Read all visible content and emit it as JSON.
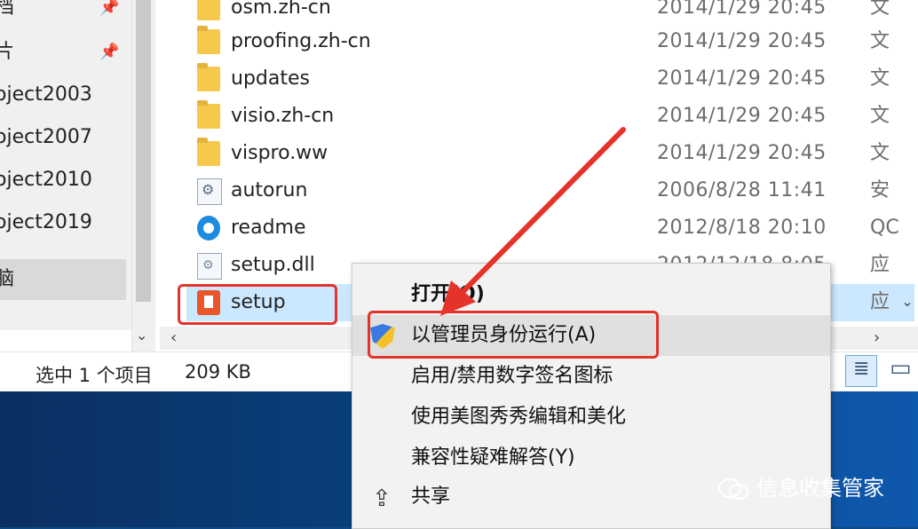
{
  "nav": {
    "items": [
      {
        "label": "档"
      },
      {
        "label": "片"
      },
      {
        "label": "oject2003"
      },
      {
        "label": "oject2007"
      },
      {
        "label": "oject2010"
      },
      {
        "label": "oject2019"
      },
      {
        "label": "脑"
      }
    ]
  },
  "files": [
    {
      "name": "osm.zh-cn",
      "date": "2014/1/29 20:45",
      "type": "文"
    },
    {
      "name": "proofing.zh-cn",
      "date": "2014/1/29 20:45",
      "type": "文"
    },
    {
      "name": "updates",
      "date": "2014/1/29 20:45",
      "type": "文"
    },
    {
      "name": "visio.zh-cn",
      "date": "2014/1/29 20:45",
      "type": "文"
    },
    {
      "name": "vispro.ww",
      "date": "2014/1/29 20:45",
      "type": "文"
    },
    {
      "name": "autorun",
      "date": "2006/8/28 11:41",
      "type": "安"
    },
    {
      "name": "readme",
      "date": "2012/8/18 20:10",
      "type": "QC"
    },
    {
      "name": "setup.dll",
      "date": "2012/12/18 8:05",
      "type": "应"
    },
    {
      "name": "setup",
      "date": "",
      "type": "应"
    }
  ],
  "status": {
    "selected": "选中 1 个项目",
    "size": "209 KB"
  },
  "menu": {
    "open": "打开(O)",
    "run_as_admin": "以管理员身份运行(A)",
    "toggle_signature": "启用/禁用数字签名图标",
    "meitu": "使用美图秀秀编辑和美化",
    "compat": "兼容性疑难解答(Y)",
    "share": "共享"
  },
  "watermark": "信息收集管家",
  "colors": {
    "highlight_box": "#e5332a",
    "selection": "#cce8ff"
  }
}
